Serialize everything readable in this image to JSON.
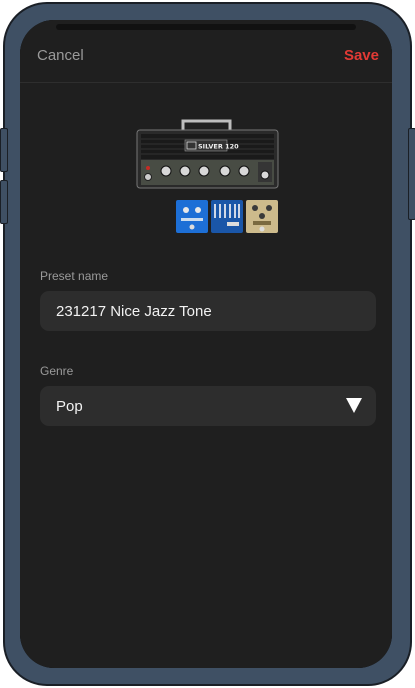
{
  "header": {
    "cancel_label": "Cancel",
    "save_label": "Save"
  },
  "rig": {
    "amp_name": "SILVER 120"
  },
  "form": {
    "preset_label": "Preset name",
    "preset_value": "231217 Nice Jazz Tone",
    "genre_label": "Genre",
    "genre_value": "Pop"
  },
  "colors": {
    "accent": "#e23a35",
    "background": "#1f1f1f",
    "field": "#2d2d2d",
    "frame": "#3f5064"
  }
}
